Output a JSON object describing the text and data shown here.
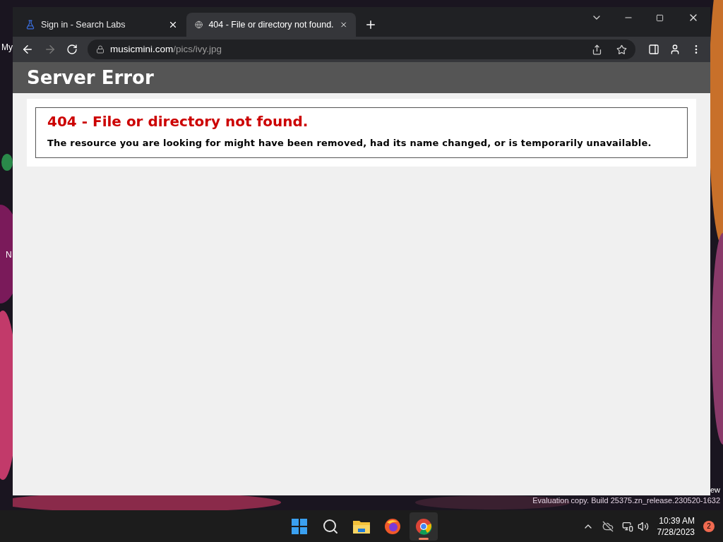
{
  "desktop": {
    "labels": [
      "My",
      "N",
      "ew"
    ],
    "watermark": "Evaluation copy. Build 25375.zn_release.230520-1632"
  },
  "browser": {
    "tabs": [
      {
        "title": "Sign in - Search Labs",
        "kind": "flask",
        "selected": false
      },
      {
        "title": "404 - File or directory not found.",
        "kind": "globe",
        "selected": true
      }
    ],
    "address": {
      "domain": "musicmini.com",
      "path": "/pics/ivy.jpg"
    }
  },
  "page": {
    "header": "Server Error",
    "error_title": "404 - File or directory not found.",
    "error_message": "The resource you are looking for might have been removed, had its name changed, or is temporarily unavailable."
  },
  "taskbar": {
    "apps": [
      {
        "kind": "start",
        "selected": false
      },
      {
        "kind": "search",
        "selected": false
      },
      {
        "kind": "files",
        "selected": false
      },
      {
        "kind": "firefox",
        "selected": false
      },
      {
        "kind": "chrome",
        "selected": true
      }
    ],
    "time": "10:39 AM",
    "date": "7/28/2023",
    "notifications": "2"
  }
}
